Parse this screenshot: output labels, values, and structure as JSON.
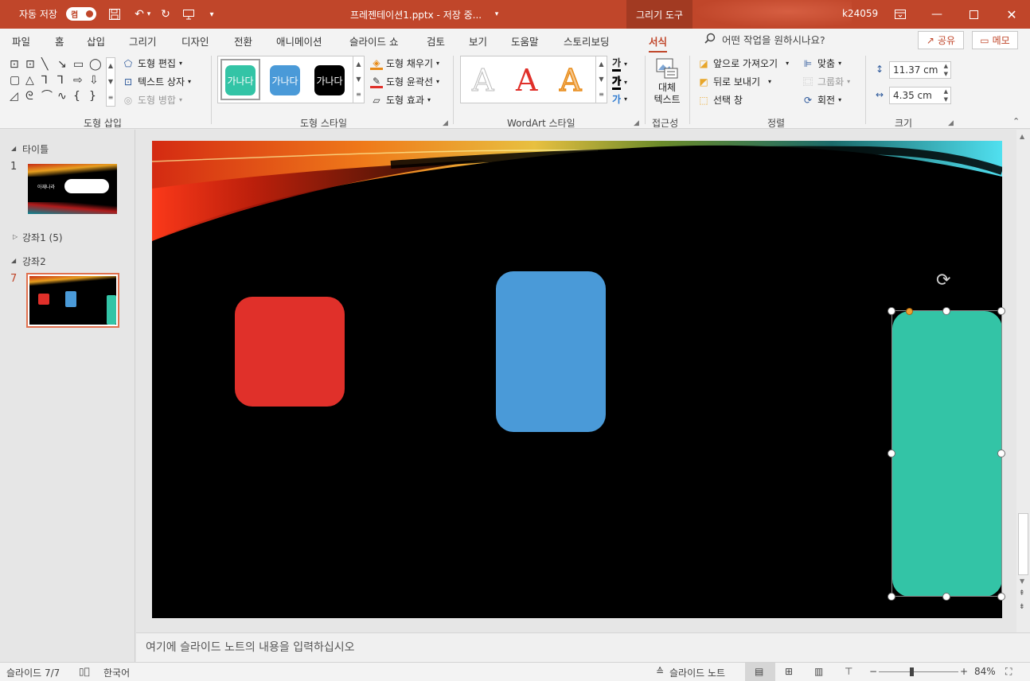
{
  "titlebar": {
    "autosave_label": "자동 저장",
    "autosave_toggle": "켬",
    "doc_title": "프레젠테이션1.pptx  -  저장 중...",
    "context_tab": "그리기 도구",
    "user": "k24059"
  },
  "ribbon_tabs": [
    "파일",
    "홈",
    "삽입",
    "그리기",
    "디자인",
    "전환",
    "애니메이션",
    "슬라이드 쇼",
    "검토",
    "보기",
    "도움말",
    "스토리보딩",
    "서식"
  ],
  "active_tab": "서식",
  "tell_me": "어떤 작업을 원하시나요?",
  "share_label": "공유",
  "comment_label": "메모",
  "groups": {
    "insert_shapes": {
      "label": "도형 삽입",
      "edit_shape": "도형 편집",
      "text_box": "텍스트 상자",
      "merge_shapes": "도형 병합"
    },
    "shape_styles": {
      "label": "도형 스타일",
      "swatch_text": "가나다",
      "swatch_colors": [
        "#33c4a6",
        "#4a9ad8",
        "#000000"
      ],
      "fill": "도형 채우기",
      "outline": "도형 윤곽선",
      "effects": "도형 효과"
    },
    "wordart": {
      "label": "WordArt 스타일",
      "glyph": "A",
      "text_glyph": "가"
    },
    "accessibility": {
      "label": "접근성",
      "alt_text_line1": "대체",
      "alt_text_line2": "텍스트"
    },
    "arrange": {
      "label": "정렬",
      "bring_forward": "앞으로 가져오기",
      "send_backward": "뒤로 보내기",
      "selection_pane": "선택 창",
      "align": "맞춤",
      "group": "그룹화",
      "rotate": "회전"
    },
    "size": {
      "label": "크기",
      "height": "11.37 cm",
      "width": "4.35 cm"
    }
  },
  "thumbnails": {
    "section_title": "타이틀",
    "section_lecture1": "강좌1 (5)",
    "section_lecture2": "강좌2",
    "slide1_number": "1",
    "slide7_number": "7",
    "slide1_caption": "아재나라"
  },
  "slide_shapes": [
    {
      "name": "red-rounded-square",
      "color": "#e0302a"
    },
    {
      "name": "blue-rounded-rectangle",
      "color": "#4a9ad8"
    },
    {
      "name": "teal-rounded-rectangle",
      "color": "#33c4a6"
    }
  ],
  "notes_placeholder": "여기에 슬라이드 노트의 내용을 입력하십시오",
  "status": {
    "slide_counter": "슬라이드 7/7",
    "language": "한국어",
    "notes_button": "슬라이드 노트",
    "zoom": "84%",
    "zoom_level": 0.84
  },
  "colors": {
    "accent": "#c0462a"
  }
}
